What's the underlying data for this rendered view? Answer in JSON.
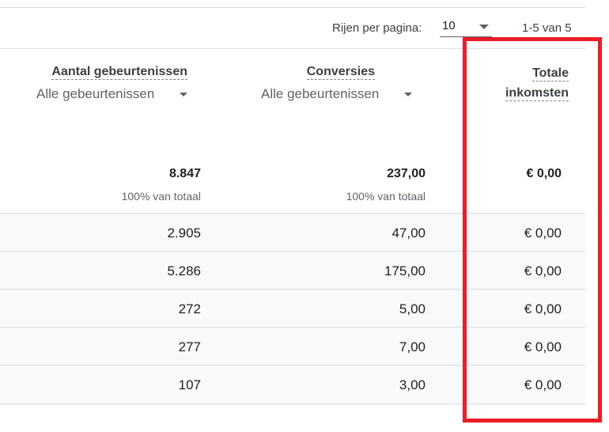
{
  "pagination": {
    "rows_per_page_label": "Rijen per pagina:",
    "rows_per_page_value": "10",
    "range_label": "1-5 van 5"
  },
  "columns": [
    {
      "title": "Aantal gebeurtenissen",
      "filter": "Alle gebeurtenissen"
    },
    {
      "title": "Conversies",
      "filter": "Alle gebeurtenissen"
    },
    {
      "title_line1": "Totale",
      "title_line2": "inkomsten"
    }
  ],
  "totals": [
    {
      "value": "8.847",
      "pct": "100% van totaal"
    },
    {
      "value": "237,00",
      "pct": "100% van totaal"
    },
    {
      "value": "€ 0,00"
    }
  ],
  "rows": [
    [
      "2.905",
      "47,00",
      "€ 0,00"
    ],
    [
      "5.286",
      "175,00",
      "€ 0,00"
    ],
    [
      "272",
      "5,00",
      "€ 0,00"
    ],
    [
      "277",
      "7,00",
      "€ 0,00"
    ],
    [
      "107",
      "3,00",
      "€ 0,00"
    ]
  ],
  "colors": {
    "highlight": "#ee1c25",
    "row_stripe": "#f8f9fa",
    "divider": "#dadce0"
  }
}
